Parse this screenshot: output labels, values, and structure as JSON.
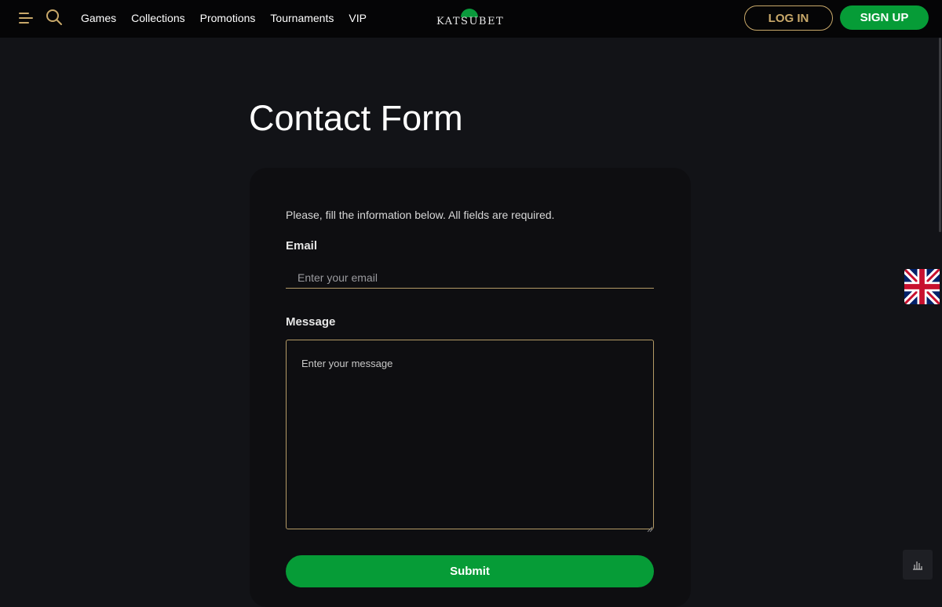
{
  "header": {
    "menu_icon": "hamburger-menu-icon",
    "search_icon": "search-icon",
    "nav": [
      "Games",
      "Collections",
      "Promotions",
      "Tournaments",
      "VIP"
    ],
    "logo_text": "KATSUBET",
    "login_label": "LOG IN",
    "signup_label": "SIGN UP"
  },
  "main": {
    "title": "Contact Form",
    "intro": "Please, fill the information below. All fields are required.",
    "email_label": "Email",
    "email_placeholder": "Enter your email",
    "message_label": "Message",
    "message_placeholder": "Enter your message",
    "submit_label": "Submit"
  },
  "side": {
    "language_flag": "uk-flag-icon",
    "stats_icon": "bar-chart-icon"
  },
  "colors": {
    "background": "#121317",
    "header": "#050506",
    "accent_gold": "#c9a96a",
    "brand_green": "#069c37",
    "card": "#0e0e11"
  }
}
